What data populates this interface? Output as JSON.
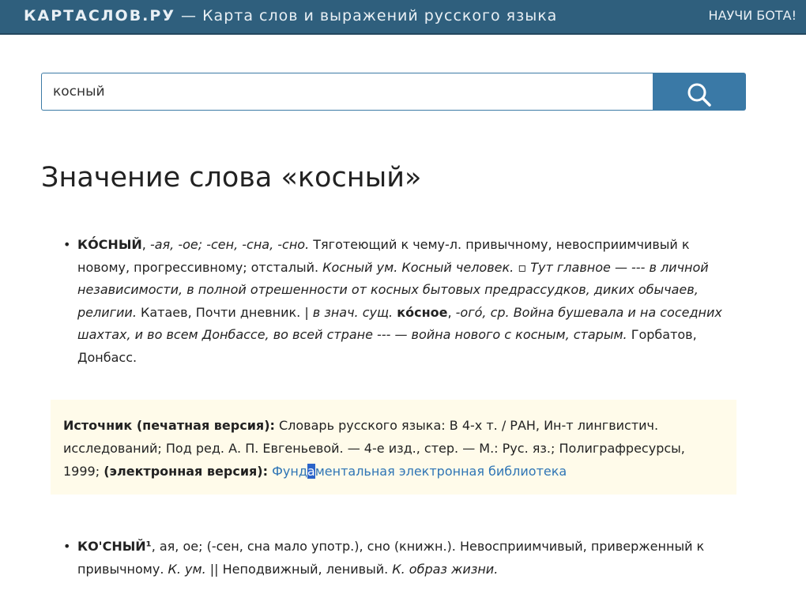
{
  "header": {
    "brand": "КАРТАСЛОВ.РУ",
    "tagline": "— Карта слов и выражений русского языка",
    "teach_bot": "НАУЧИ БОТА!"
  },
  "search": {
    "value": "косный",
    "button_icon": "search-icon"
  },
  "page_title": "Значение слова «косный»",
  "entry1": {
    "headword": "КО́СНЫЙ",
    "p1": ", ",
    "forms": "-ая, -ое; -сен, -сна, -сно.",
    "p2": " Тяготеющий к чему-л. привычному, невосприимчивый к новому, прогрессивному; отсталый. ",
    "ex1": "Косный ум. Косный человек.",
    "p3": " ▫ ",
    "ex2": "Тут главное — --- в личной независимости, в полной отрешенности от косных бытовых предрассудков, диких обычаев, религии.",
    "p4": " Катаев, Почти дневник. | ",
    "note": "в знач. сущ.",
    "p5": " ",
    "sub_headword": "ко́сное",
    "p6": ", ",
    "sub_forms": "-ого́, ср.",
    "p7": " ",
    "ex3": "Война бушевала и на соседних шахтах, и во всем Донбассе, во всей стране --- — война нового с косным, старым.",
    "p8": " Горбатов, Донбасс."
  },
  "source": {
    "print_label": "Источник (печатная версия):",
    "print_text": " Словарь русского языка: В 4-х т. / РАН, Ин-т лингвистич. исследований; Под ред. А. П. Евгеньевой. — 4-е изд., стер. — М.: Рус. яз.; Полиграфресурсы, 1999; ",
    "electronic_label": "(электронная версия):",
    "space": " ",
    "link_part1": "Фунд",
    "link_selected": "а",
    "link_part2": "ментальная электронная библиотека"
  },
  "entry2": {
    "headword": "КО'СНЫЙ¹",
    "p1": ", ая, ое; (-сен, сна мало употр.), сно (книжн.). Невосприимчивый, приверженный к привычному. ",
    "ex1": "К. ум.",
    "p2": " || Неподвижный, ленивый. ",
    "ex2": "К. образ жизни."
  },
  "colors": {
    "header_bg": "#2f5f7d",
    "accent": "#3a79a6",
    "link": "#2f75b5",
    "source_bg": "#fffbea"
  }
}
